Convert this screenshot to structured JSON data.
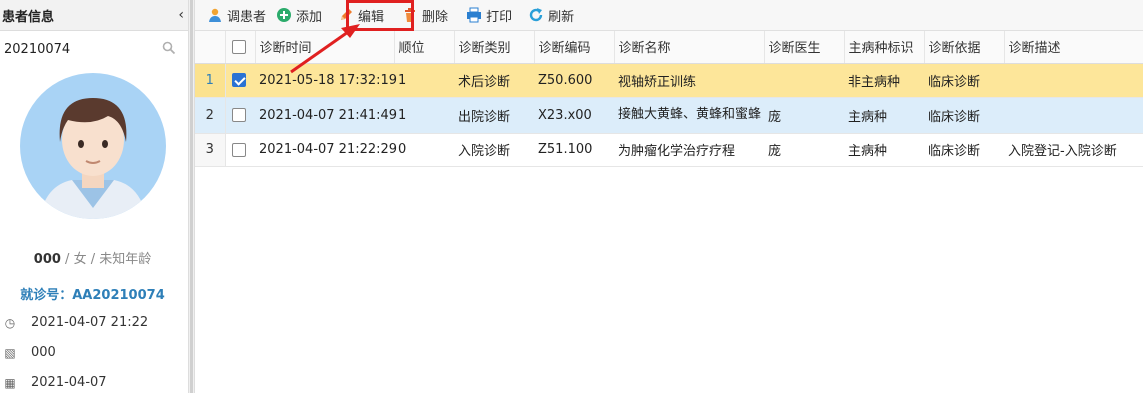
{
  "sidebar": {
    "title": "患者信息",
    "search_value": "20210074",
    "patient_name": "000",
    "patient_gender_age": " / 女 / 未知年龄",
    "visit_label": "就诊号：",
    "visit_no": "AA20210074",
    "meta": [
      {
        "icon": "clock-icon",
        "glyph": "◷",
        "text": "2021-04-07 21:22"
      },
      {
        "icon": "image-icon",
        "glyph": "▧",
        "text": "000"
      },
      {
        "icon": "calendar-icon",
        "glyph": "▦",
        "text": "2021-04-07"
      }
    ]
  },
  "toolbar": {
    "buttons": [
      {
        "key": "call",
        "label": "调患者",
        "icon": "user-icon"
      },
      {
        "key": "add",
        "label": "添加",
        "icon": "plus-circle-icon"
      },
      {
        "key": "edit",
        "label": "编辑",
        "icon": "pencil-icon"
      },
      {
        "key": "delete",
        "label": "删除",
        "icon": "trash-icon"
      },
      {
        "key": "print",
        "label": "打印",
        "icon": "printer-icon"
      },
      {
        "key": "refresh",
        "label": "刷新",
        "icon": "refresh-icon"
      }
    ]
  },
  "table": {
    "headers": [
      "诊断时间",
      "顺位",
      "诊断类别",
      "诊断编码",
      "诊断名称",
      "诊断医生",
      "主病种标识",
      "诊断依据",
      "诊断描述"
    ],
    "rows": [
      {
        "index": "1",
        "checked": true,
        "cells": [
          "2021-05-18 17:32:19",
          "1",
          "术后诊断",
          "Z50.600",
          "视轴矫正训练",
          "",
          "非主病种",
          "临床诊断",
          ""
        ]
      },
      {
        "index": "2",
        "checked": false,
        "cells": [
          "2021-04-07 21:41:49",
          "1",
          "出院诊断",
          "X23.x00",
          "接触大黄蜂、黄蜂和蜜蜂",
          "庞",
          "主病种",
          "临床诊断",
          ""
        ]
      },
      {
        "index": "3",
        "checked": false,
        "cells": [
          "2021-04-07 21:22:29",
          "0",
          "入院诊断",
          "Z51.100",
          "为肿瘤化学治疗疗程",
          "庞",
          "主病种",
          "临床诊断",
          "入院登记-入院诊断"
        ]
      }
    ]
  },
  "colors": {
    "selected_row": "#fde69a",
    "hover_row": "#dcedfa",
    "accent": "#2e7fb8",
    "highlight": "#e02020"
  }
}
